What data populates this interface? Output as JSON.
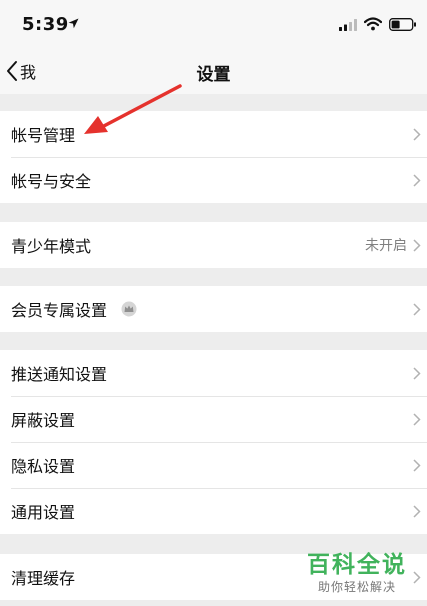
{
  "status_bar": {
    "time": "5:39"
  },
  "nav": {
    "back_label": "我",
    "title": "设置"
  },
  "groups": [
    {
      "items": [
        {
          "label": "帐号管理"
        },
        {
          "label": "帐号与安全"
        }
      ]
    },
    {
      "items": [
        {
          "label": "青少年模式",
          "value": "未开启"
        }
      ]
    },
    {
      "items": [
        {
          "label": "会员专属设置"
        }
      ]
    },
    {
      "items": [
        {
          "label": "推送通知设置"
        },
        {
          "label": "屏蔽设置"
        },
        {
          "label": "隐私设置"
        },
        {
          "label": "通用设置"
        }
      ]
    },
    {
      "items": [
        {
          "label": "清理缓存"
        }
      ]
    }
  ],
  "watermark": {
    "title": "百科全说",
    "subtitle": "助你轻松解决"
  },
  "colors": {
    "arrow": "#e5322d",
    "watermark": "#41b35c",
    "background": "#ededed"
  },
  "icons": [
    "location-arrow-icon",
    "signal-icon",
    "wifi-icon",
    "battery-icon",
    "chevron-left-icon",
    "chevron-right-icon",
    "crown-icon"
  ]
}
